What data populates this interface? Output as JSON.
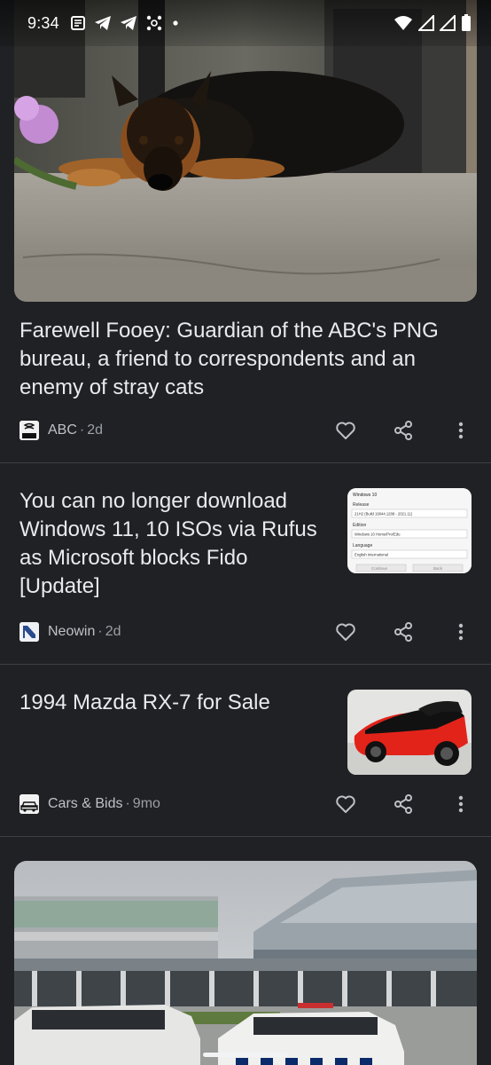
{
  "status_bar": {
    "time": "9:34"
  },
  "cards": [
    {
      "title": "Farewell Fooey: Guardian of the ABC's PNG bureau, a friend to correspondents and an enemy of stray cats",
      "source": "ABC",
      "age": "2d",
      "logo_text": "ABC"
    },
    {
      "title": "You can no longer download Windows 11, 10 ISOs via Rufus as Microsoft blocks Fido [Update]",
      "source": "Neowin",
      "age": "2d",
      "thumb": {
        "heading": "Windows 10",
        "release_label": "Release",
        "release_value": "21H2 (Build 19044.1288 - 2021.11)",
        "edition_label": "Edition",
        "edition_value": "Windows 10 Home/Pro/Edu",
        "language_label": "Language",
        "language_value": "English International",
        "continue": "Continue",
        "back": "Back"
      }
    },
    {
      "title": "1994 Mazda RX-7 for Sale",
      "source": "Cars & Bids",
      "age": "9mo"
    }
  ],
  "meta_separator": "·",
  "colors": {
    "background": "#202124",
    "divider": "#3c4043",
    "text_primary": "#e8eaed",
    "text_secondary": "#9aa0a6"
  }
}
